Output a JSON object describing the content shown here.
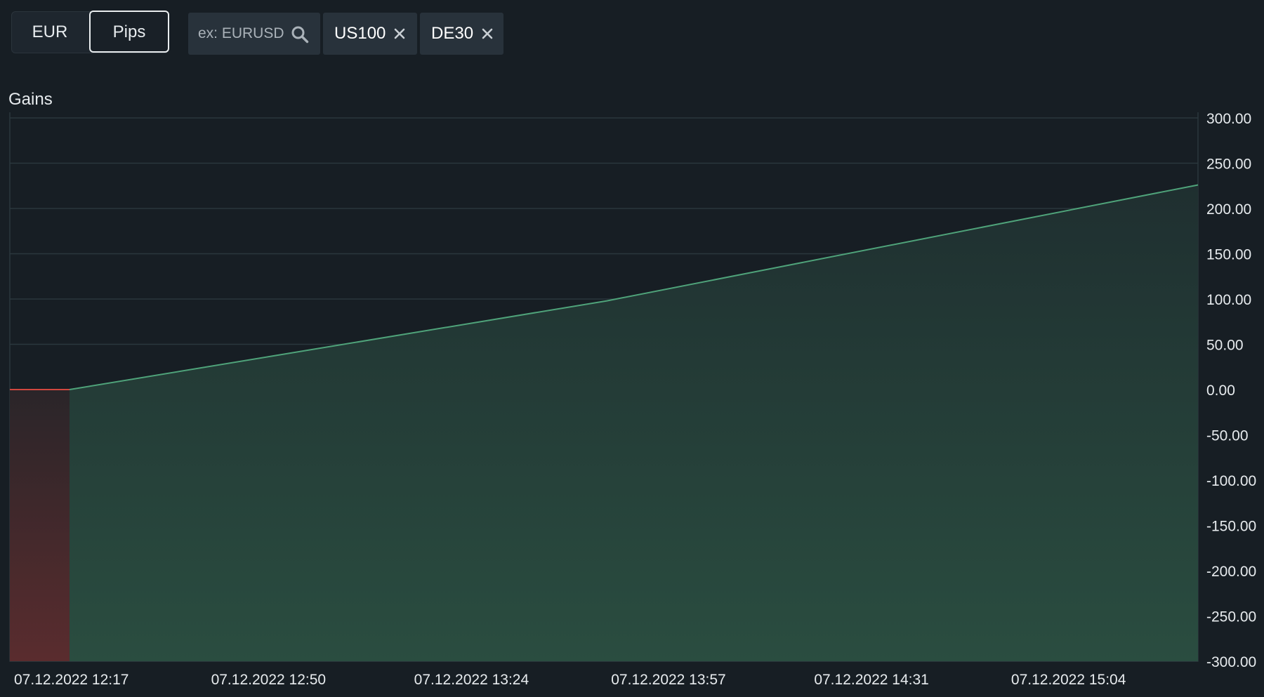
{
  "toolbar": {
    "unit_options": [
      {
        "label": "EUR",
        "selected": false
      },
      {
        "label": "Pips",
        "selected": true
      }
    ],
    "search": {
      "placeholder": "ex: EURUSD",
      "value": "",
      "icon": "search-icon"
    },
    "filters": [
      {
        "label": "US100",
        "icon": "close-icon"
      },
      {
        "label": "DE30",
        "icon": "close-icon"
      }
    ]
  },
  "panel": {
    "title": "Gains"
  },
  "colors": {
    "positive_line": "#4fa37a",
    "positive_fill": "#2a4d40",
    "negative_line": "#d0473f",
    "negative_fill": "#5a2c2e",
    "grid": "#2a373d",
    "axis_text": "#e7ebee",
    "background": "#171e24"
  },
  "chart_data": {
    "type": "area",
    "title": "",
    "xlabel": "",
    "ylabel": "",
    "ylim": [
      -300,
      300
    ],
    "y_ticks": [
      "300.00",
      "250.00",
      "200.00",
      "150.00",
      "100.00",
      "50.00",
      "0.00",
      "-50.00",
      "-100.00",
      "-150.00",
      "-200.00",
      "-250.00",
      "-300.00"
    ],
    "x_ticks": [
      "07.12.2022 12:17",
      "07.12.2022 12:50",
      "07.12.2022 13:24",
      "07.12.2022 13:57",
      "07.12.2022 14:31",
      "07.12.2022 15:04"
    ],
    "x_range": [
      "07.12.2022 12:17",
      "07.12.2022 15:36"
    ],
    "grid": true,
    "y_axis_position": "right",
    "series": [
      {
        "points": [
          {
            "x": "07.12.2022 12:17",
            "y": 0,
            "color": "negative"
          },
          {
            "x": "07.12.2022 12:27",
            "y": 0,
            "color": "positive"
          },
          {
            "x": "07.12.2022 13:57",
            "y": 98
          },
          {
            "x": "07.12.2022 15:36",
            "y": 226
          }
        ]
      }
    ]
  }
}
